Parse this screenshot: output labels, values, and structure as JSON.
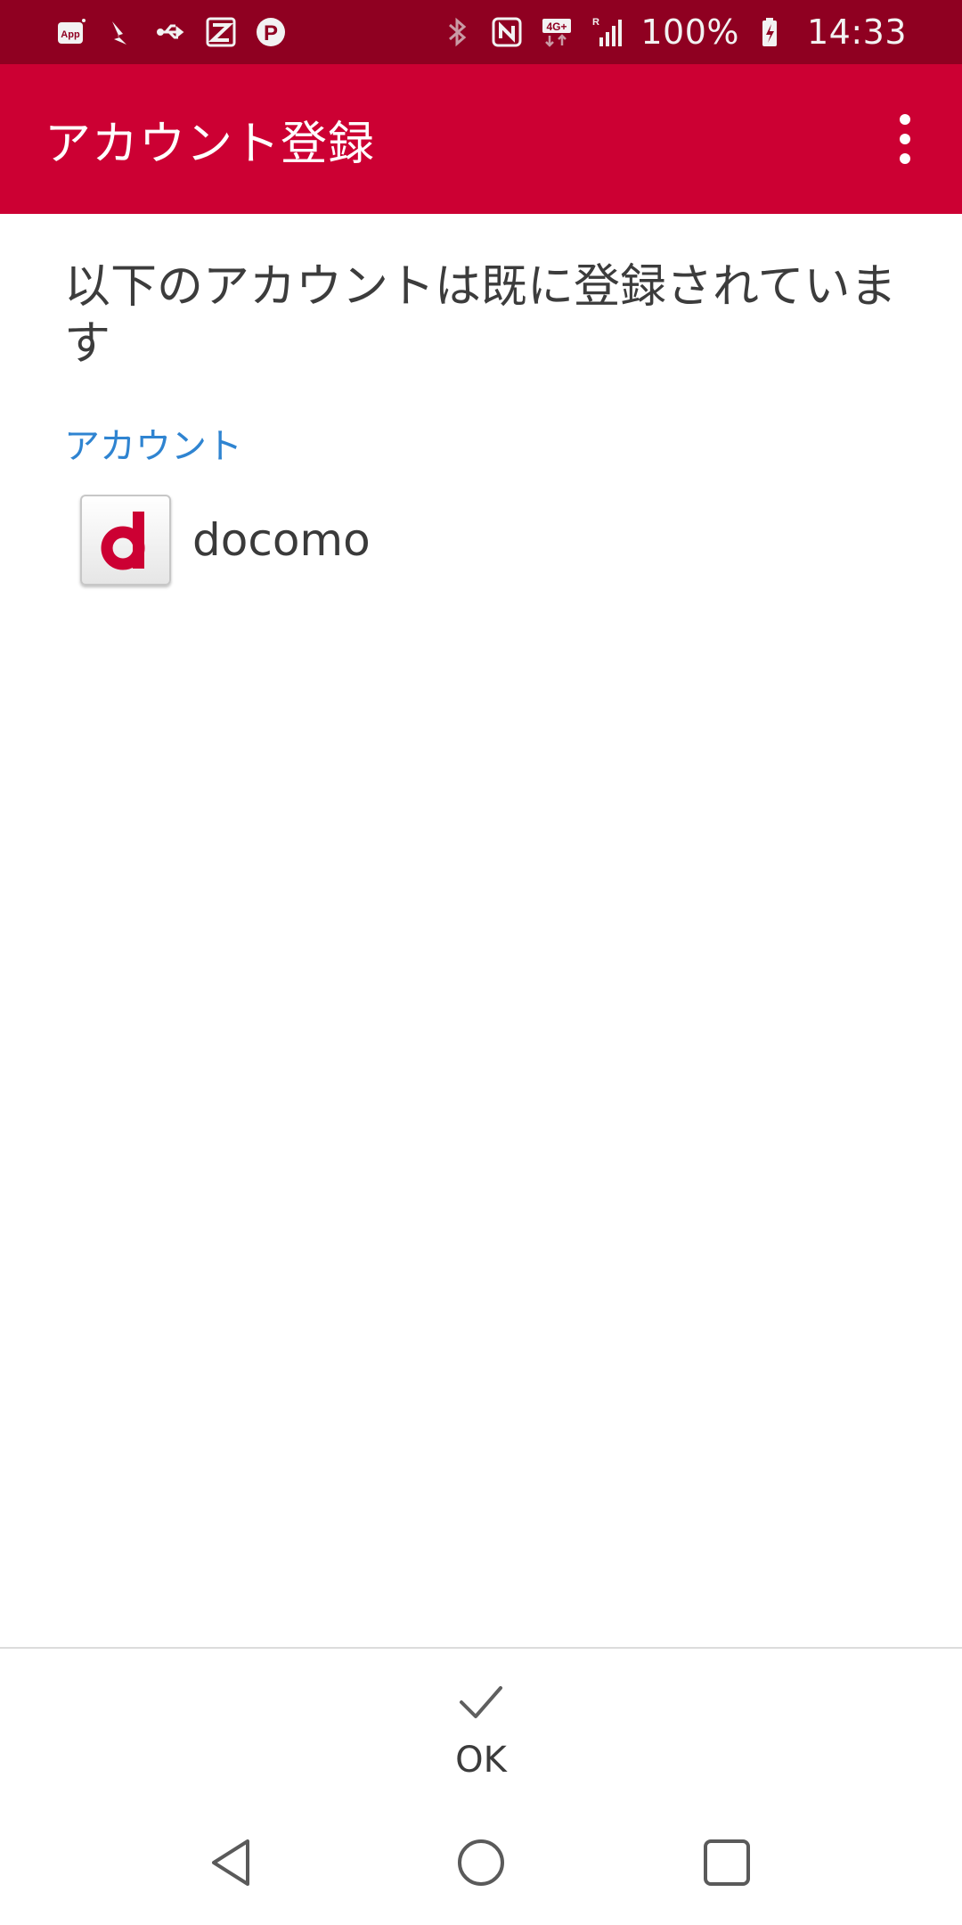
{
  "status_bar": {
    "battery_percent": "100%",
    "time": "14:33",
    "network": "4G+",
    "roaming": "R",
    "left_icons": [
      "app-notification-icon",
      "download-icon",
      "usb-icon",
      "app-z-icon",
      "app-p-icon"
    ],
    "right_icons": [
      "bluetooth-icon",
      "nfc-icon",
      "network-4g-icon",
      "signal-icon",
      "battery-charging-icon"
    ]
  },
  "app_bar": {
    "title": "アカウント登録",
    "overflow_icon": "more-vert-icon"
  },
  "content": {
    "heading": "以下のアカウントは既に登録されています",
    "section_label": "アカウント",
    "accounts": [
      {
        "name": "docomo",
        "logo": "docomo-d-logo"
      }
    ]
  },
  "actions": {
    "ok_label": "OK",
    "ok_icon": "check-icon"
  },
  "nav_bar": {
    "buttons": [
      "back-icon",
      "home-icon",
      "recents-icon"
    ]
  },
  "colors": {
    "status_bar": "#8f0021",
    "app_bar": "#cc0033",
    "accent_label": "#2f84d1",
    "docomo_red": "#cc0033"
  }
}
